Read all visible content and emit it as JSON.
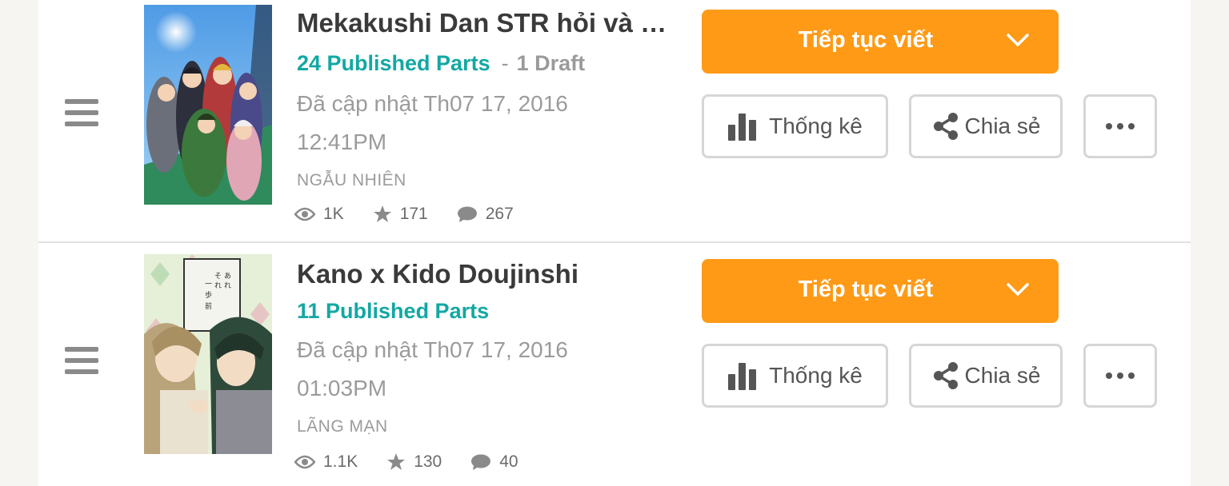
{
  "stories": [
    {
      "title": "Mekakushi Dan STR hỏi và …",
      "published_parts": "24 Published Parts",
      "separator": "-",
      "drafts": "1 Draft",
      "updated_line1": "Đã cập nhật Th07 17, 2016",
      "updated_line2": "12:41PM",
      "genre": "NGẪU NHIÊN",
      "reads": "1K",
      "votes": "171",
      "comments": "267",
      "continue_label": "Tiếp tục viết",
      "stats_label": "Thống kê",
      "share_label": "Chia sẻ"
    },
    {
      "title": "Kano x Kido Doujinshi",
      "published_parts": "11 Published Parts",
      "updated_line1": "Đã cập nhật Th07 17, 2016",
      "updated_line2": "01:03PM",
      "genre": "LÃNG MẠN",
      "reads": "1.1K",
      "votes": "130",
      "comments": "40",
      "continue_label": "Tiếp tục viết",
      "stats_label": "Thống kê",
      "share_label": "Chia sẻ"
    }
  ],
  "colors": {
    "accent": "#ff9a17",
    "published_teal": "#13a8a3",
    "muted_text": "#9b9b9b",
    "divider": "#e1e1e1",
    "button_border": "#d6d6d6"
  },
  "icons": [
    "drag-handle-icon",
    "eye-icon",
    "star-icon",
    "comment-icon",
    "chevron-down-icon",
    "bar-chart-icon",
    "share-icon",
    "more-dots-icon"
  ]
}
